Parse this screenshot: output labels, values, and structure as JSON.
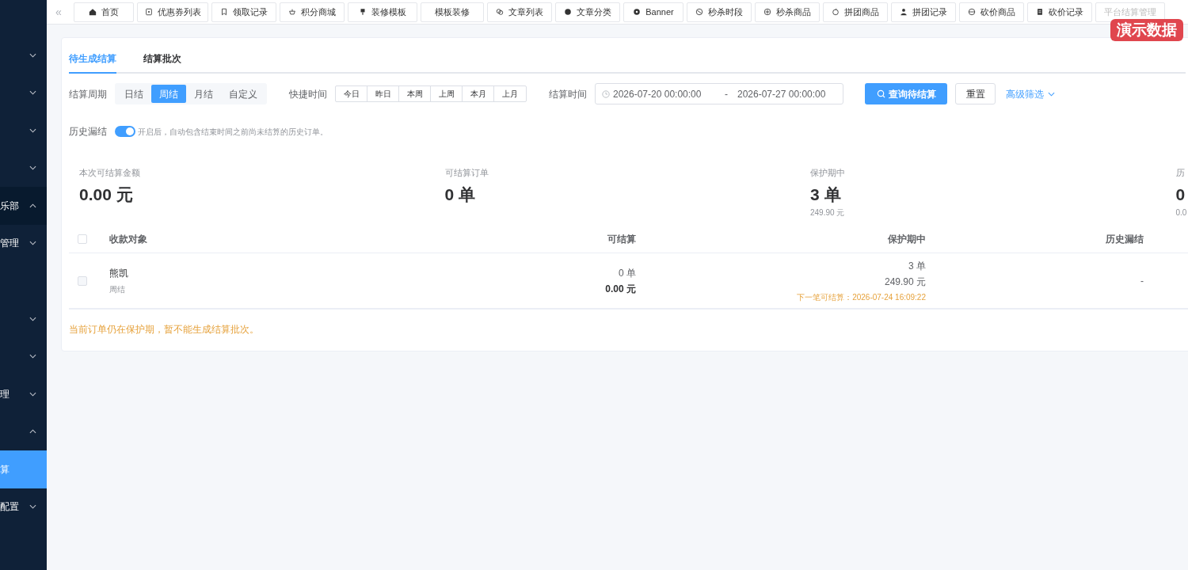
{
  "sidebar": {
    "items": [
      {
        "expanded": false,
        "selected": false
      },
      {
        "expanded": false,
        "selected": false
      },
      {
        "expanded": false,
        "selected": false
      },
      {
        "expanded": false,
        "selected": false
      },
      {
        "label": "乐部",
        "expanded": true,
        "selected": false
      },
      {
        "label": "管理",
        "expanded": false,
        "selected": false
      },
      {
        "kind": "blank"
      },
      {
        "expanded": false,
        "selected": false
      },
      {
        "expanded": false,
        "selected": false
      },
      {
        "label": "理",
        "expanded": false,
        "selected": false
      },
      {
        "expanded": true,
        "selected": false
      },
      {
        "label": "算",
        "selected": true
      },
      {
        "label": "配置",
        "expanded": false,
        "selected": false
      }
    ]
  },
  "tabs_bar": {
    "collapse": "«",
    "tabs": [
      {
        "label": "首页",
        "selected": false
      },
      {
        "label": "优惠券列表",
        "selected": false
      },
      {
        "label": "领取记录",
        "selected": false
      },
      {
        "label": "积分商城",
        "selected": false
      },
      {
        "label": "装修模板",
        "selected": false
      },
      {
        "label": "模板装修",
        "selected": false
      },
      {
        "label": "文章列表",
        "selected": false
      },
      {
        "label": "文章分类",
        "selected": false
      },
      {
        "label": "Banner",
        "selected": false
      },
      {
        "label": "秒杀时段",
        "selected": false
      },
      {
        "label": "秒杀商品",
        "selected": false
      },
      {
        "label": "拼团商品",
        "selected": false
      },
      {
        "label": "拼团记录",
        "selected": false
      },
      {
        "label": "砍价商品",
        "selected": false
      },
      {
        "label": "砍价记录",
        "selected": false
      },
      {
        "label": "平台结算管理",
        "selected": true
      }
    ]
  },
  "demo_badge": "演示数据",
  "page_tabs": [
    {
      "label": "待生成结算",
      "selected": true
    },
    {
      "label": "结算批次",
      "selected": false
    }
  ],
  "filters": {
    "period_label": "结算周期",
    "periods": [
      {
        "label": "日结",
        "selected": false
      },
      {
        "label": "周结",
        "selected": true
      },
      {
        "label": "月结",
        "selected": false
      },
      {
        "label": "自定义",
        "selected": false
      }
    ],
    "quick_label": "快捷时间",
    "quick": [
      {
        "label": "今日",
        "selected": false
      },
      {
        "label": "昨日",
        "selected": false
      },
      {
        "label": "本周",
        "selected": false
      },
      {
        "label": "上周",
        "selected": false
      },
      {
        "label": "本月",
        "selected": false
      },
      {
        "label": "上月",
        "selected": false
      }
    ],
    "time_label": "结算时间",
    "start": "2026-07-20 00:00:00",
    "separator": "-",
    "end": "2026-07-27 00:00:00",
    "search_button": "查询待结算",
    "reset_button": "重置",
    "advanced": "高级筛选"
  },
  "history": {
    "label": "历史漏结",
    "on": true,
    "hint": "开启后，自动包含结束时间之前尚未结算的历史订单。"
  },
  "stats": [
    {
      "label": "本次可结算金额",
      "value": "0.00 元"
    },
    {
      "label": "可结算订单",
      "value": "0 单"
    },
    {
      "label": "保护期中",
      "value": "3 单",
      "sub": "249.90 元"
    },
    {
      "label": "历",
      "value": "0",
      "sub": "0.0"
    }
  ],
  "table": {
    "all_checked": false,
    "columns": [
      "收款对象",
      "可结算",
      "保护期中",
      "历史漏结"
    ],
    "rows": [
      {
        "checked": false,
        "name": "熊凯",
        "cycle": "周结",
        "settle_count": "0 单",
        "settle_amount": "0.00 元",
        "protect_count": "3 单",
        "protect_amount": "249.90 元",
        "next_time": "下一笔可结算：2026-07-24 16:09:22",
        "history": "-"
      }
    ]
  },
  "notice": "当前订单仍在保护期，暂不能生成结算批次。"
}
